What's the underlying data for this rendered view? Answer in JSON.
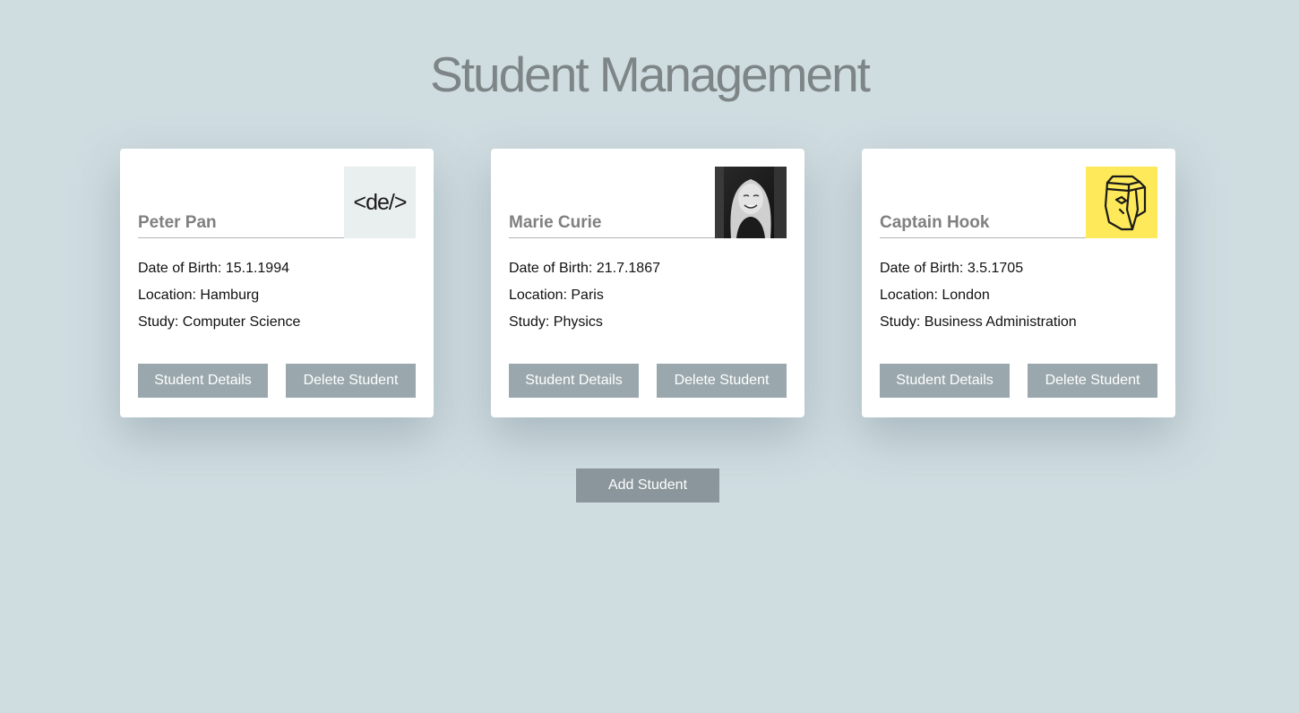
{
  "page": {
    "title": "Student Management"
  },
  "students": [
    {
      "name": "Peter Pan",
      "avatar": "code-de-logo",
      "dob_label": "Date of Birth: 15.1.1994",
      "location_label": "Location: Hamburg",
      "study_label": "Study: Computer Science",
      "details_label": "Student Details",
      "delete_label": "Delete Student"
    },
    {
      "name": "Marie Curie",
      "avatar": "portrait-photo",
      "dob_label": "Date of Birth: 21.7.1867",
      "location_label": "Location: Paris",
      "study_label": "Study: Physics",
      "details_label": "Student Details",
      "delete_label": "Delete Student"
    },
    {
      "name": "Captain Hook",
      "avatar": "face-outline-logo",
      "dob_label": "Date of Birth: 3.5.1705",
      "location_label": "Location: London",
      "study_label": "Study: Business Administration",
      "details_label": "Student Details",
      "delete_label": "Delete Student"
    }
  ],
  "actions": {
    "add_label": "Add Student"
  },
  "colors": {
    "background": "#cfdce0",
    "card_button": "#9aa8ad",
    "add_button": "#8a969b",
    "title": "#7d8587",
    "avatar_yellow": "#fde95a"
  }
}
